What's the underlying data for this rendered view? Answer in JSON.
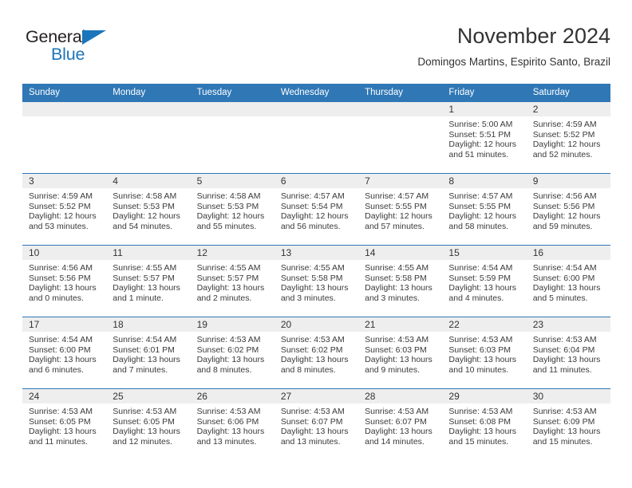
{
  "brand": {
    "name_part1": "General",
    "name_part2": "Blue",
    "triangle_color": "#1b75bb"
  },
  "header": {
    "title": "November 2024",
    "subtitle": "Domingos Martins, Espirito Santo, Brazil"
  },
  "theme": {
    "header_blue": "#2f77b5",
    "daynum_band": "#eeeeee",
    "text": "#333333"
  },
  "weekdays": [
    "Sunday",
    "Monday",
    "Tuesday",
    "Wednesday",
    "Thursday",
    "Friday",
    "Saturday"
  ],
  "weeks": [
    [
      {
        "day": "",
        "sunrise": "",
        "sunset": "",
        "daylight1": "",
        "daylight2": ""
      },
      {
        "day": "",
        "sunrise": "",
        "sunset": "",
        "daylight1": "",
        "daylight2": ""
      },
      {
        "day": "",
        "sunrise": "",
        "sunset": "",
        "daylight1": "",
        "daylight2": ""
      },
      {
        "day": "",
        "sunrise": "",
        "sunset": "",
        "daylight1": "",
        "daylight2": ""
      },
      {
        "day": "",
        "sunrise": "",
        "sunset": "",
        "daylight1": "",
        "daylight2": ""
      },
      {
        "day": "1",
        "sunrise": "Sunrise: 5:00 AM",
        "sunset": "Sunset: 5:51 PM",
        "daylight1": "Daylight: 12 hours",
        "daylight2": "and 51 minutes."
      },
      {
        "day": "2",
        "sunrise": "Sunrise: 4:59 AM",
        "sunset": "Sunset: 5:52 PM",
        "daylight1": "Daylight: 12 hours",
        "daylight2": "and 52 minutes."
      }
    ],
    [
      {
        "day": "3",
        "sunrise": "Sunrise: 4:59 AM",
        "sunset": "Sunset: 5:52 PM",
        "daylight1": "Daylight: 12 hours",
        "daylight2": "and 53 minutes."
      },
      {
        "day": "4",
        "sunrise": "Sunrise: 4:58 AM",
        "sunset": "Sunset: 5:53 PM",
        "daylight1": "Daylight: 12 hours",
        "daylight2": "and 54 minutes."
      },
      {
        "day": "5",
        "sunrise": "Sunrise: 4:58 AM",
        "sunset": "Sunset: 5:53 PM",
        "daylight1": "Daylight: 12 hours",
        "daylight2": "and 55 minutes."
      },
      {
        "day": "6",
        "sunrise": "Sunrise: 4:57 AM",
        "sunset": "Sunset: 5:54 PM",
        "daylight1": "Daylight: 12 hours",
        "daylight2": "and 56 minutes."
      },
      {
        "day": "7",
        "sunrise": "Sunrise: 4:57 AM",
        "sunset": "Sunset: 5:55 PM",
        "daylight1": "Daylight: 12 hours",
        "daylight2": "and 57 minutes."
      },
      {
        "day": "8",
        "sunrise": "Sunrise: 4:57 AM",
        "sunset": "Sunset: 5:55 PM",
        "daylight1": "Daylight: 12 hours",
        "daylight2": "and 58 minutes."
      },
      {
        "day": "9",
        "sunrise": "Sunrise: 4:56 AM",
        "sunset": "Sunset: 5:56 PM",
        "daylight1": "Daylight: 12 hours",
        "daylight2": "and 59 minutes."
      }
    ],
    [
      {
        "day": "10",
        "sunrise": "Sunrise: 4:56 AM",
        "sunset": "Sunset: 5:56 PM",
        "daylight1": "Daylight: 13 hours",
        "daylight2": "and 0 minutes."
      },
      {
        "day": "11",
        "sunrise": "Sunrise: 4:55 AM",
        "sunset": "Sunset: 5:57 PM",
        "daylight1": "Daylight: 13 hours",
        "daylight2": "and 1 minute."
      },
      {
        "day": "12",
        "sunrise": "Sunrise: 4:55 AM",
        "sunset": "Sunset: 5:57 PM",
        "daylight1": "Daylight: 13 hours",
        "daylight2": "and 2 minutes."
      },
      {
        "day": "13",
        "sunrise": "Sunrise: 4:55 AM",
        "sunset": "Sunset: 5:58 PM",
        "daylight1": "Daylight: 13 hours",
        "daylight2": "and 3 minutes."
      },
      {
        "day": "14",
        "sunrise": "Sunrise: 4:55 AM",
        "sunset": "Sunset: 5:58 PM",
        "daylight1": "Daylight: 13 hours",
        "daylight2": "and 3 minutes."
      },
      {
        "day": "15",
        "sunrise": "Sunrise: 4:54 AM",
        "sunset": "Sunset: 5:59 PM",
        "daylight1": "Daylight: 13 hours",
        "daylight2": "and 4 minutes."
      },
      {
        "day": "16",
        "sunrise": "Sunrise: 4:54 AM",
        "sunset": "Sunset: 6:00 PM",
        "daylight1": "Daylight: 13 hours",
        "daylight2": "and 5 minutes."
      }
    ],
    [
      {
        "day": "17",
        "sunrise": "Sunrise: 4:54 AM",
        "sunset": "Sunset: 6:00 PM",
        "daylight1": "Daylight: 13 hours",
        "daylight2": "and 6 minutes."
      },
      {
        "day": "18",
        "sunrise": "Sunrise: 4:54 AM",
        "sunset": "Sunset: 6:01 PM",
        "daylight1": "Daylight: 13 hours",
        "daylight2": "and 7 minutes."
      },
      {
        "day": "19",
        "sunrise": "Sunrise: 4:53 AM",
        "sunset": "Sunset: 6:02 PM",
        "daylight1": "Daylight: 13 hours",
        "daylight2": "and 8 minutes."
      },
      {
        "day": "20",
        "sunrise": "Sunrise: 4:53 AM",
        "sunset": "Sunset: 6:02 PM",
        "daylight1": "Daylight: 13 hours",
        "daylight2": "and 8 minutes."
      },
      {
        "day": "21",
        "sunrise": "Sunrise: 4:53 AM",
        "sunset": "Sunset: 6:03 PM",
        "daylight1": "Daylight: 13 hours",
        "daylight2": "and 9 minutes."
      },
      {
        "day": "22",
        "sunrise": "Sunrise: 4:53 AM",
        "sunset": "Sunset: 6:03 PM",
        "daylight1": "Daylight: 13 hours",
        "daylight2": "and 10 minutes."
      },
      {
        "day": "23",
        "sunrise": "Sunrise: 4:53 AM",
        "sunset": "Sunset: 6:04 PM",
        "daylight1": "Daylight: 13 hours",
        "daylight2": "and 11 minutes."
      }
    ],
    [
      {
        "day": "24",
        "sunrise": "Sunrise: 4:53 AM",
        "sunset": "Sunset: 6:05 PM",
        "daylight1": "Daylight: 13 hours",
        "daylight2": "and 11 minutes."
      },
      {
        "day": "25",
        "sunrise": "Sunrise: 4:53 AM",
        "sunset": "Sunset: 6:05 PM",
        "daylight1": "Daylight: 13 hours",
        "daylight2": "and 12 minutes."
      },
      {
        "day": "26",
        "sunrise": "Sunrise: 4:53 AM",
        "sunset": "Sunset: 6:06 PM",
        "daylight1": "Daylight: 13 hours",
        "daylight2": "and 13 minutes."
      },
      {
        "day": "27",
        "sunrise": "Sunrise: 4:53 AM",
        "sunset": "Sunset: 6:07 PM",
        "daylight1": "Daylight: 13 hours",
        "daylight2": "and 13 minutes."
      },
      {
        "day": "28",
        "sunrise": "Sunrise: 4:53 AM",
        "sunset": "Sunset: 6:07 PM",
        "daylight1": "Daylight: 13 hours",
        "daylight2": "and 14 minutes."
      },
      {
        "day": "29",
        "sunrise": "Sunrise: 4:53 AM",
        "sunset": "Sunset: 6:08 PM",
        "daylight1": "Daylight: 13 hours",
        "daylight2": "and 15 minutes."
      },
      {
        "day": "30",
        "sunrise": "Sunrise: 4:53 AM",
        "sunset": "Sunset: 6:09 PM",
        "daylight1": "Daylight: 13 hours",
        "daylight2": "and 15 minutes."
      }
    ]
  ]
}
